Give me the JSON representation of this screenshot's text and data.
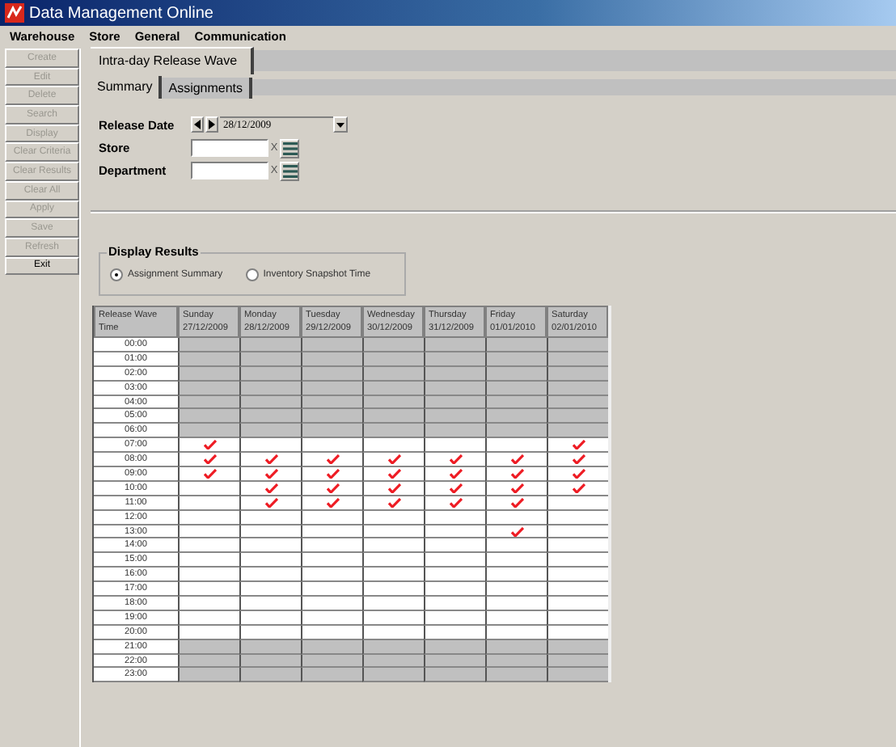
{
  "window": {
    "title": "Data Management Online"
  },
  "menu": [
    "Warehouse",
    "Store",
    "General",
    "Communication"
  ],
  "sidebar_buttons": [
    {
      "label": "Create",
      "disabled": true
    },
    {
      "label": "Edit",
      "disabled": true
    },
    {
      "label": "Delete",
      "disabled": true
    },
    {
      "label": "Search",
      "disabled": true
    },
    {
      "label": "Display",
      "disabled": true
    },
    {
      "label": "Clear Criteria",
      "disabled": true
    },
    {
      "label": "Clear Results",
      "disabled": true
    },
    {
      "label": "Clear All",
      "disabled": true
    },
    {
      "label": "Apply",
      "disabled": true
    },
    {
      "label": "Save",
      "disabled": true
    },
    {
      "label": "Refresh",
      "disabled": true
    },
    {
      "label": "Exit",
      "disabled": false
    }
  ],
  "main_tab": "Intra-day Release Wave",
  "tabs": [
    {
      "label": "Summary",
      "selected": true
    },
    {
      "label": "Assignments",
      "selected": false
    }
  ],
  "form": {
    "release_date_label": "Release Date",
    "release_date": "28/12/2009",
    "fields": [
      {
        "label": "Store",
        "clear_button": "X"
      },
      {
        "label": "Department",
        "clear_button": "X"
      }
    ]
  },
  "display_results": {
    "title": "Display Results",
    "options": [
      {
        "label": "Assignment Summary",
        "selected": true
      },
      {
        "label": "Inventory Snapshot Time",
        "selected": false
      }
    ]
  },
  "table": {
    "columns": [
      [
        "Release Wave",
        "Time"
      ],
      [
        "Sunday",
        "27/12/2009"
      ],
      [
        "Monday",
        "28/12/2009"
      ],
      [
        "Tuesday",
        "29/12/2009"
      ],
      [
        "Wednesday",
        "30/12/2009"
      ],
      [
        "Thursday",
        "31/12/2009"
      ],
      [
        "Friday",
        "01/01/2010"
      ],
      [
        "Saturday",
        "02/01/2010"
      ]
    ],
    "rows": [
      {
        "time": "00:00",
        "available": false,
        "checked": [
          false,
          false,
          false,
          false,
          false,
          false,
          false
        ]
      },
      {
        "time": "01:00",
        "available": false,
        "checked": [
          false,
          false,
          false,
          false,
          false,
          false,
          false
        ]
      },
      {
        "time": "02:00",
        "available": false,
        "checked": [
          false,
          false,
          false,
          false,
          false,
          false,
          false
        ]
      },
      {
        "time": "03:00",
        "available": false,
        "checked": [
          false,
          false,
          false,
          false,
          false,
          false,
          false
        ]
      },
      {
        "time": "04:00",
        "available": false,
        "checked": [
          false,
          false,
          false,
          false,
          false,
          false,
          false
        ]
      },
      {
        "time": "05:00",
        "available": false,
        "checked": [
          false,
          false,
          false,
          false,
          false,
          false,
          false
        ]
      },
      {
        "time": "06:00",
        "available": false,
        "checked": [
          false,
          false,
          false,
          false,
          false,
          false,
          false
        ]
      },
      {
        "time": "07:00",
        "available": true,
        "checked": [
          true,
          false,
          false,
          false,
          false,
          false,
          true
        ]
      },
      {
        "time": "08:00",
        "available": true,
        "checked": [
          true,
          true,
          true,
          true,
          true,
          true,
          true
        ]
      },
      {
        "time": "09:00",
        "available": true,
        "checked": [
          true,
          true,
          true,
          true,
          true,
          true,
          true
        ]
      },
      {
        "time": "10:00",
        "available": true,
        "checked": [
          false,
          true,
          true,
          true,
          true,
          true,
          true
        ]
      },
      {
        "time": "11:00",
        "available": true,
        "checked": [
          false,
          true,
          true,
          true,
          true,
          true,
          false
        ]
      },
      {
        "time": "12:00",
        "available": true,
        "checked": [
          false,
          false,
          false,
          false,
          false,
          false,
          false
        ]
      },
      {
        "time": "13:00",
        "available": true,
        "checked": [
          false,
          false,
          false,
          false,
          false,
          true,
          false
        ]
      },
      {
        "time": "14:00",
        "available": true,
        "checked": [
          false,
          false,
          false,
          false,
          false,
          false,
          false
        ]
      },
      {
        "time": "15:00",
        "available": true,
        "checked": [
          false,
          false,
          false,
          false,
          false,
          false,
          false
        ]
      },
      {
        "time": "16:00",
        "available": true,
        "checked": [
          false,
          false,
          false,
          false,
          false,
          false,
          false
        ]
      },
      {
        "time": "17:00",
        "available": true,
        "checked": [
          false,
          false,
          false,
          false,
          false,
          false,
          false
        ]
      },
      {
        "time": "18:00",
        "available": true,
        "checked": [
          false,
          false,
          false,
          false,
          false,
          false,
          false
        ]
      },
      {
        "time": "19:00",
        "available": true,
        "checked": [
          false,
          false,
          false,
          false,
          false,
          false,
          false
        ]
      },
      {
        "time": "20:00",
        "available": true,
        "checked": [
          false,
          false,
          false,
          false,
          false,
          false,
          false
        ]
      },
      {
        "time": "21:00",
        "available": false,
        "checked": [
          false,
          false,
          false,
          false,
          false,
          false,
          false
        ]
      },
      {
        "time": "22:00",
        "available": false,
        "checked": [
          false,
          false,
          false,
          false,
          false,
          false,
          false
        ]
      },
      {
        "time": "23:00",
        "available": false,
        "checked": [
          false,
          false,
          false,
          false,
          false,
          false,
          false
        ]
      }
    ]
  }
}
